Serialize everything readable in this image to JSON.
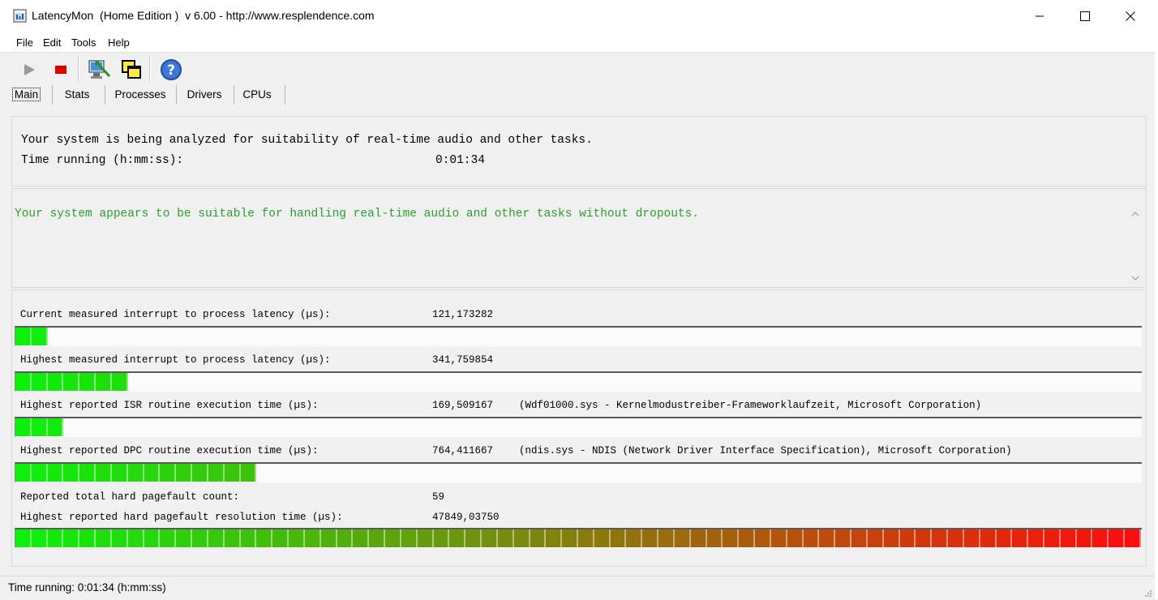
{
  "window": {
    "title": "LatencyMon  (Home Edition )  v 6.00 - http://www.resplendence.com",
    "controls": [
      "minimize",
      "maximize",
      "close"
    ]
  },
  "menu": {
    "file": "File",
    "edit": "Edit",
    "tools": "Tools",
    "help": "Help"
  },
  "toolbar": {
    "icons": [
      "play-icon",
      "stop-icon",
      "system-scan-icon",
      "windows-icon",
      "help-icon"
    ]
  },
  "tabs": {
    "main": "Main",
    "stats": "Stats",
    "processes": "Processes",
    "drivers": "Drivers",
    "cpus": "CPUs",
    "selected": "Main"
  },
  "analysis": {
    "line1": "Your system is being analyzed for suitability of real-time audio and other tasks.",
    "time_label": "Time running (h:mm:ss):",
    "time_value": "0:01:34"
  },
  "verdict": {
    "text": "Your system appears to be suitable for handling real-time audio and other tasks without dropouts.",
    "color": "#2ca02c"
  },
  "metrics": [
    {
      "label": "Current measured interrupt to process latency (µs):",
      "value": "121,173282",
      "detail": "",
      "bar_segments": 2
    },
    {
      "label": "Highest measured interrupt to process latency (µs):",
      "value": "341,759854",
      "detail": "",
      "bar_segments": 7
    },
    {
      "label": "Highest reported ISR routine execution time (µs):",
      "value": "169,509167",
      "detail": "(Wdf01000.sys - Kernelmodustreiber-Frameworklaufzeit, Microsoft Corporation)",
      "bar_segments": 3
    },
    {
      "label": "Highest reported DPC routine execution time (µs):",
      "value": "764,411667",
      "detail": "(ndis.sys - NDIS (Network Driver Interface Specification), Microsoft Corporation)",
      "bar_segments": 15
    },
    {
      "label": "Reported total hard pagefault count:",
      "value": "59",
      "detail": ""
    },
    {
      "label": "Highest reported hard pagefault resolution time (µs):",
      "value": "47849,03750",
      "detail": "",
      "bar_segments": 70
    }
  ],
  "bar_total_segments": 70,
  "colors": {
    "gauge_start": "#0cf00c",
    "gauge_end": "#ff0c0c"
  },
  "status": {
    "text": "Time running: 0:01:34  (h:mm:ss)"
  }
}
